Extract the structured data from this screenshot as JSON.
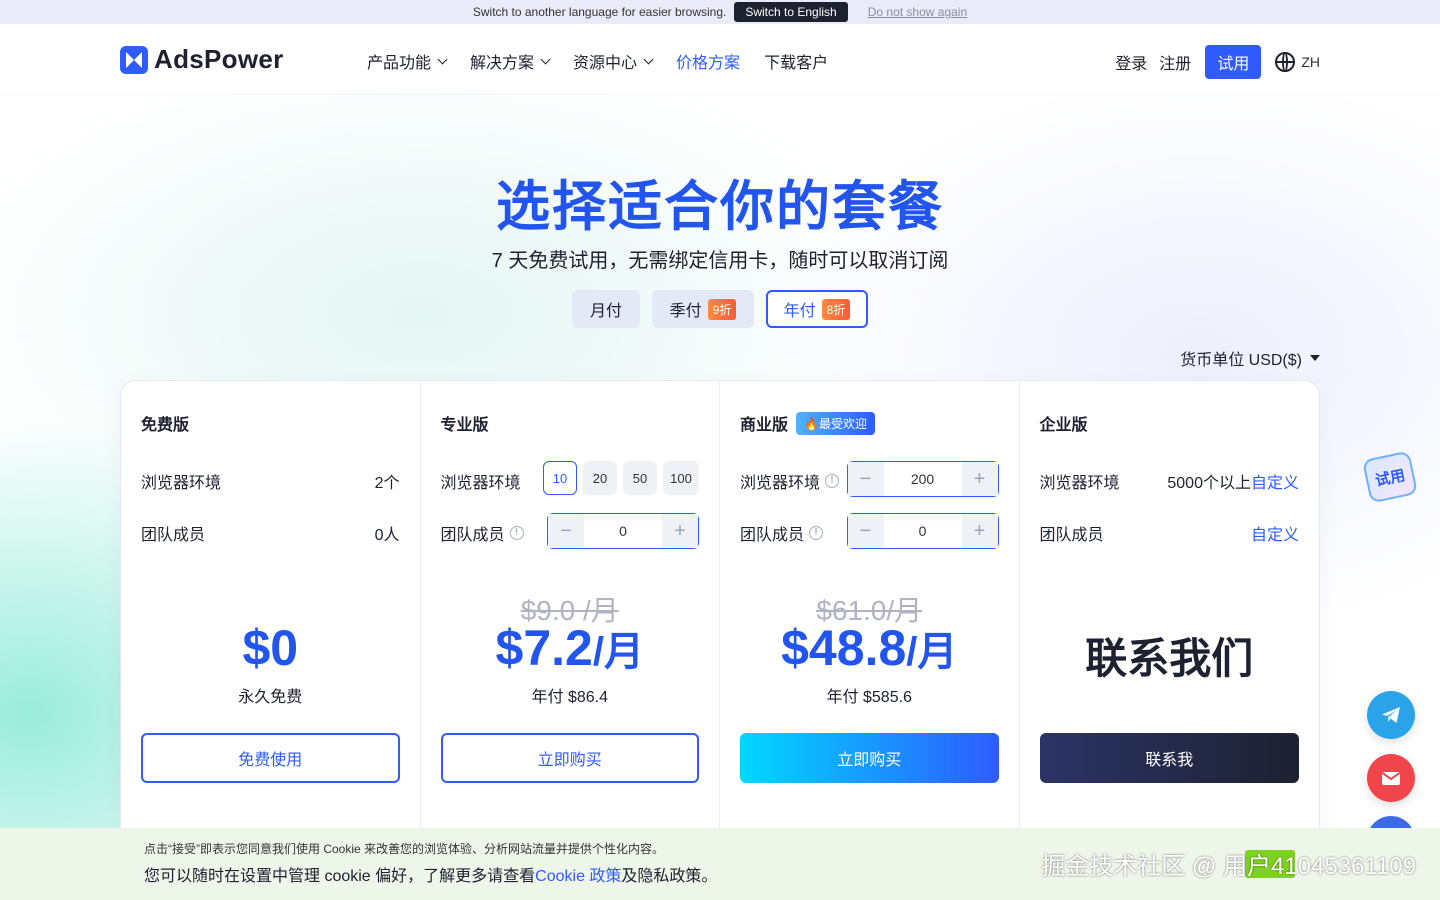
{
  "lang_bar": {
    "message": "Switch to another language for easier browsing.",
    "switch_label": "Switch to English",
    "dismiss_label": "Do not show again"
  },
  "header": {
    "logo_text": "AdsPower",
    "nav": [
      "产品功能",
      "解决方案",
      "资源中心",
      "价格方案",
      "下载客户"
    ],
    "links": [
      "登录",
      "注册"
    ],
    "cta": "试用",
    "lang_code": "ZH"
  },
  "hero": {
    "title": "选择适合你的套餐",
    "subtitle": "7 天免费试用，无需绑定信用卡，随时可以取消订阅",
    "billing": [
      {
        "label": "月付"
      },
      {
        "label": "季付",
        "badge": "9折"
      },
      {
        "label": "年付",
        "badge": "8折"
      }
    ],
    "currency": "货币单位 USD($)"
  },
  "plans": [
    {
      "name": "免费版",
      "row1_label": "浏览器环境",
      "row1_value": "2个",
      "row2_label": "团队成员",
      "row2_value": "0人",
      "price": "$0",
      "note": "永久免费",
      "cta": "免费使用"
    },
    {
      "name": "专业版",
      "row1_label": "浏览器环境",
      "pill_options": [
        "10",
        "20",
        "50",
        "100"
      ],
      "pill_selected": "10",
      "row2_label": "团队成员",
      "row2_value": "0",
      "old_price": "$9.0 /月",
      "price": "$7.2",
      "price_unit": "/月",
      "note": "年付 $86.4",
      "cta": "立即购买"
    },
    {
      "name": "商业版",
      "tag": "🔥最受欢迎",
      "row1_label": "浏览器环境",
      "row1_value": "200",
      "row2_label": "团队成员",
      "row2_value": "0",
      "old_price": "$61.0/月",
      "price": "$48.8",
      "price_unit": "/月",
      "note": "年付 $585.6",
      "cta": "立即购买"
    },
    {
      "name": "企业版",
      "row1_label": "浏览器环境",
      "row1_value": "5000个以上",
      "row1_link": "自定义",
      "row2_label": "团队成员",
      "row2_link": "自定义",
      "price": "联系我们",
      "cta": "联系我"
    }
  ],
  "floating": {
    "trial_label": "试用"
  },
  "cookie": {
    "line1": "点击“接受”即表示您同意我们使用 Cookie 来改善您的浏览体验、分析网站流量并提供个性化内容。",
    "line2_before": "您可以随时在设置中管理 cookie 偏好，了解更多请查看",
    "line2_link": "Cookie 政策",
    "line2_after": "及隐私政策。",
    "watermark": "掘金技术社区 @ 用户41045361109"
  },
  "colors": {
    "primary": "#2f5bff",
    "title_blue": "#2255ee",
    "badge_orange": "#ff6a36"
  }
}
